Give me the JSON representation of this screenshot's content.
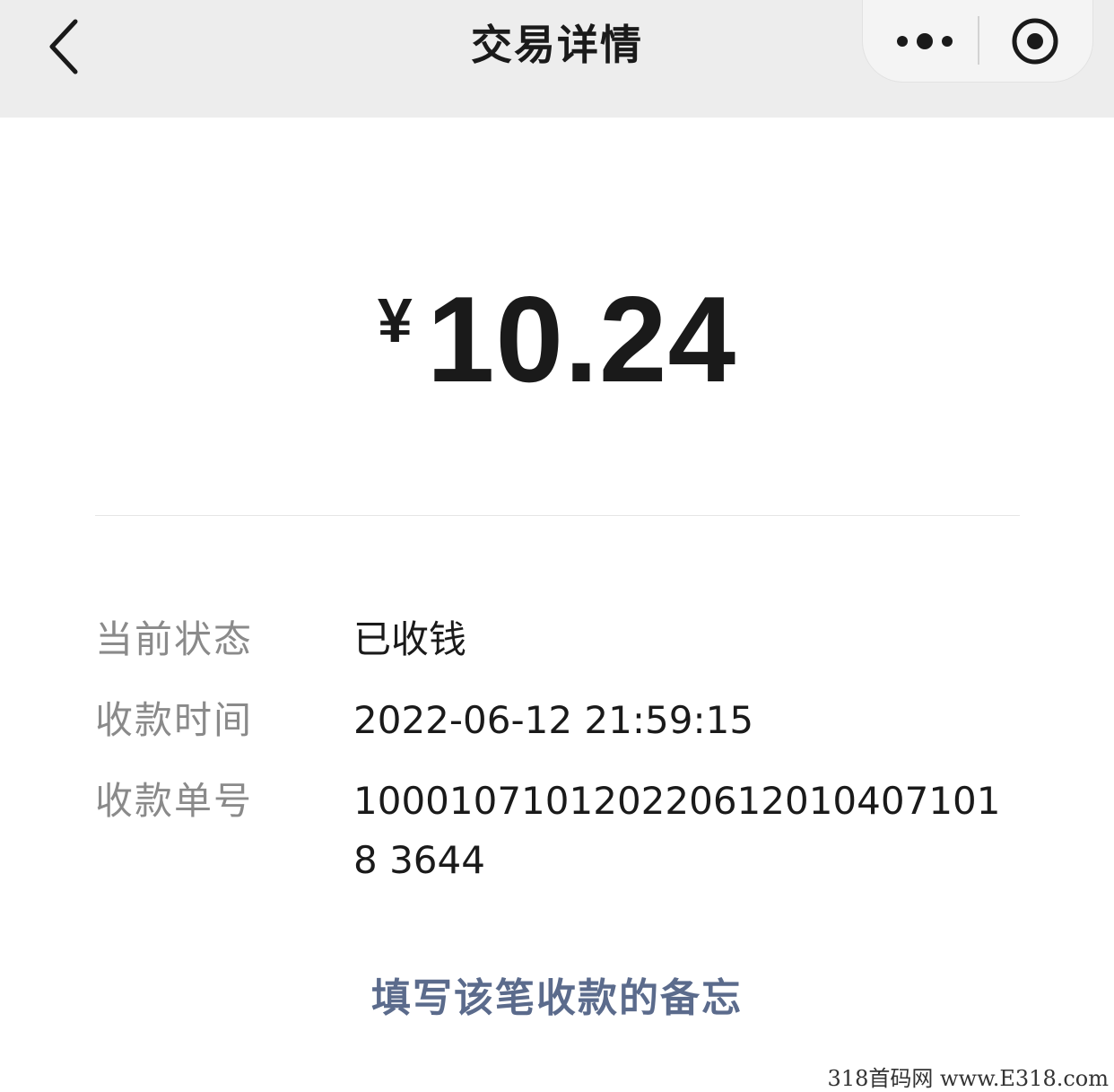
{
  "nav": {
    "title": "交易详情",
    "back_icon": "chevron-left-icon",
    "more_icon": "more-dots-icon",
    "close_icon": "target-close-icon"
  },
  "amount": {
    "currency": "¥",
    "value": "10.24"
  },
  "details": {
    "status_label": "当前状态",
    "status_value": "已收钱",
    "time_label": "收款时间",
    "time_value": "2022-06-12 21:59:15",
    "order_label": "收款单号",
    "order_value": "1000107101202206120104071018 3644"
  },
  "memo_link": "填写该笔收款的备忘",
  "watermark": "318首码网 www.E318.com",
  "colors": {
    "nav_bg": "#ededed",
    "link": "#5b6b8c",
    "label": "#8a8a8a",
    "text": "#1a1a1a"
  }
}
